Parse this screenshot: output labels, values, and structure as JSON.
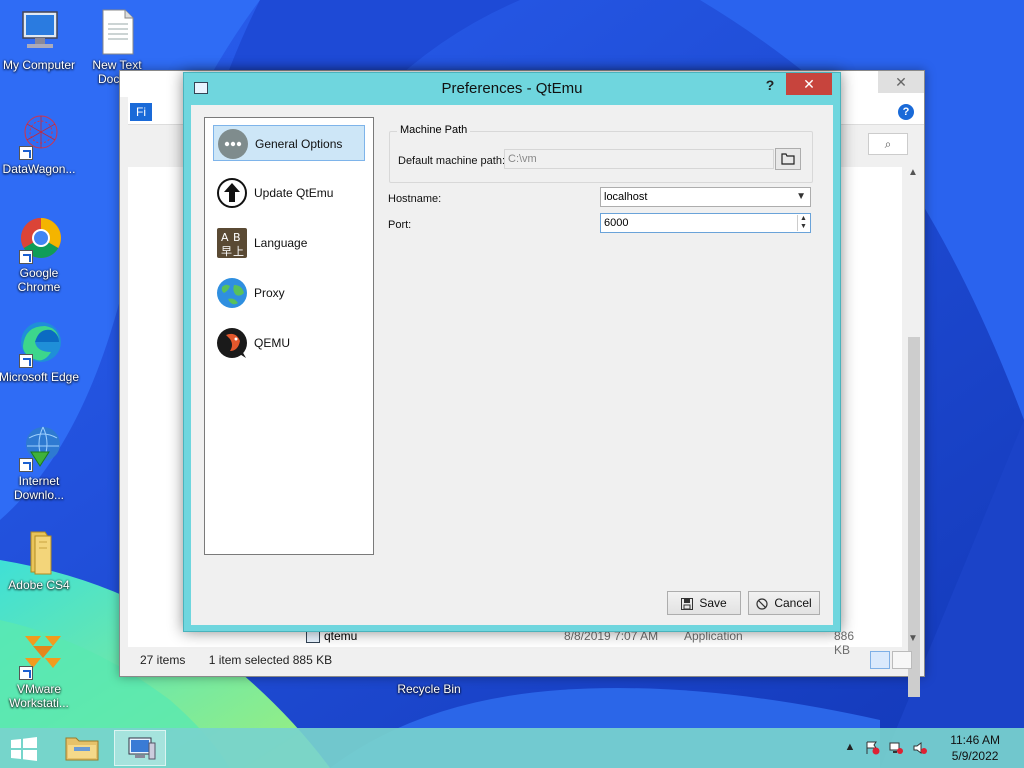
{
  "desktop": {
    "icons": [
      {
        "label": "My Computer"
      },
      {
        "label": "New Text Docu..."
      },
      {
        "label": "DataWagon..."
      },
      {
        "label": "Google Chrome"
      },
      {
        "label": "Microsoft Edge"
      },
      {
        "label": "Internet Downlo..."
      },
      {
        "label": "Adobe CS4"
      },
      {
        "label": "VMware Workstati..."
      },
      {
        "label": "Recycle Bin"
      }
    ]
  },
  "explorer": {
    "ribbon_tab": "Fi",
    "address_stub": "Fil",
    "file": {
      "name": "qtemu",
      "date": "8/8/2019 7:07 AM",
      "type": "Application",
      "size": "886 KB"
    },
    "status": {
      "item_count": "27 items",
      "selection": "1 item selected  885 KB"
    }
  },
  "dialog": {
    "title": "Preferences - QtEmu",
    "help_glyph": "?",
    "close_glyph": "✕",
    "nav_items": [
      {
        "label": "General Options",
        "icon": "more-dots-icon",
        "selected": true
      },
      {
        "label": "Update QtEmu",
        "icon": "update-arrow-icon",
        "selected": false
      },
      {
        "label": "Language",
        "icon": "language-icon",
        "selected": false
      },
      {
        "label": "Proxy",
        "icon": "globe-icon",
        "selected": false
      },
      {
        "label": "QEMU",
        "icon": "qemu-logo-icon",
        "selected": false
      }
    ],
    "machine_path": {
      "group_title": "Machine Path",
      "label": "Default machine path:",
      "value": "C:\\vm"
    },
    "hostname": {
      "label": "Hostname:",
      "value": "localhost"
    },
    "port": {
      "label": "Port:",
      "value": "6000"
    },
    "buttons": {
      "save": "Save",
      "cancel": "Cancel"
    }
  },
  "taskbar": {
    "clock_time": "11:46 AM",
    "clock_date": "5/9/2022"
  },
  "colors": {
    "dialog_frame": "#6fd6de",
    "close_red": "#c7443d",
    "selection_blue": "#cde6f7",
    "taskbar": "#78d2cd"
  }
}
